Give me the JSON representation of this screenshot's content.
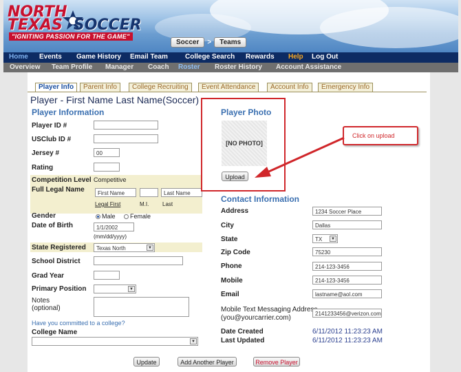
{
  "header": {
    "logo_north": "NORTH",
    "logo_texas": "TEXAS",
    "logo_soccer": "SOCCER",
    "slogan": "\"IGNITING PASSION FOR THE GAME\"",
    "crumbs": [
      "Soccer",
      ">",
      "Teams"
    ],
    "brand_red": "#c8102e",
    "brand_navy": "#0d2b63"
  },
  "nav_primary": [
    "Home",
    "Events",
    "Game History",
    "Email Team",
    "College Search",
    "Rewards",
    "Help",
    "Log Out"
  ],
  "nav_secondary": [
    "Overview",
    "Team Profile",
    "Manager",
    "Coach",
    "Roster",
    "Roster History",
    "Account Assistance"
  ],
  "tabs": [
    "Player Info",
    "Parent Info",
    "College Recruiting",
    "Event Attendance",
    "Account Info",
    "Emergency Info"
  ],
  "page_title": "Player - First Name Last Name(Soccer)",
  "player_info": {
    "heading": "Player Information",
    "player_id_label": "Player ID #",
    "usclub_label": "USClub ID #",
    "jersey_label": "Jersey #",
    "jersey_value": "00",
    "rating_label": "Rating",
    "competition_label": "Competition Level",
    "competition_value": "Competitive",
    "legal_name_label": "Full Legal Name",
    "first_placeholder": "First Name",
    "last_placeholder": "Last Name",
    "first_caption": "Legal First",
    "mi_caption": "M.I.",
    "last_caption": "Last",
    "gender_label": "Gender",
    "gender_male": "Male",
    "gender_female": "Female",
    "dob_label": "Date of Birth",
    "dob_value": "1/1/2002",
    "dob_format": "(mm/dd/yyyy)",
    "state_label": "State Registered",
    "state_value": "Texas North",
    "school_label": "School District",
    "grad_label": "Grad Year",
    "position_label": "Primary Position",
    "notes_label": "Notes",
    "notes_sub": "(optional)",
    "committed_q": "Have you committed to a college?",
    "college_label": "College Name"
  },
  "photo": {
    "heading": "Player Photo",
    "placeholder": "[NO PHOTO]",
    "upload_label": "Upload",
    "callout": "Click on upload"
  },
  "contact": {
    "heading": "Contact Information",
    "address_label": "Address",
    "address_value": "1234 Soccer Place",
    "city_label": "City",
    "city_value": "Dallas",
    "state_label": "State",
    "state_value": "TX",
    "zip_label": "Zip Code",
    "zip_value": "75230",
    "phone_label": "Phone",
    "phone_value": "214-123-3456",
    "mobile_label": "Mobile",
    "mobile_value": "214-123-3456",
    "email_label": "Email",
    "email_value": "lastname@aol.com",
    "sms_label": "Mobile Text Messaging Address",
    "sms_sub": "(you@yourcarrier.com)",
    "sms_value": "2141233456@verizon.com",
    "created_label": "Date Created",
    "created_value": "6/11/2012 11:23:23 AM",
    "updated_label": "Last Updated",
    "updated_value": "6/11/2012 11:23:23 AM"
  },
  "buttons": {
    "update": "Update",
    "add_player": "Add Another Player",
    "remove_player": "Remove Player"
  }
}
